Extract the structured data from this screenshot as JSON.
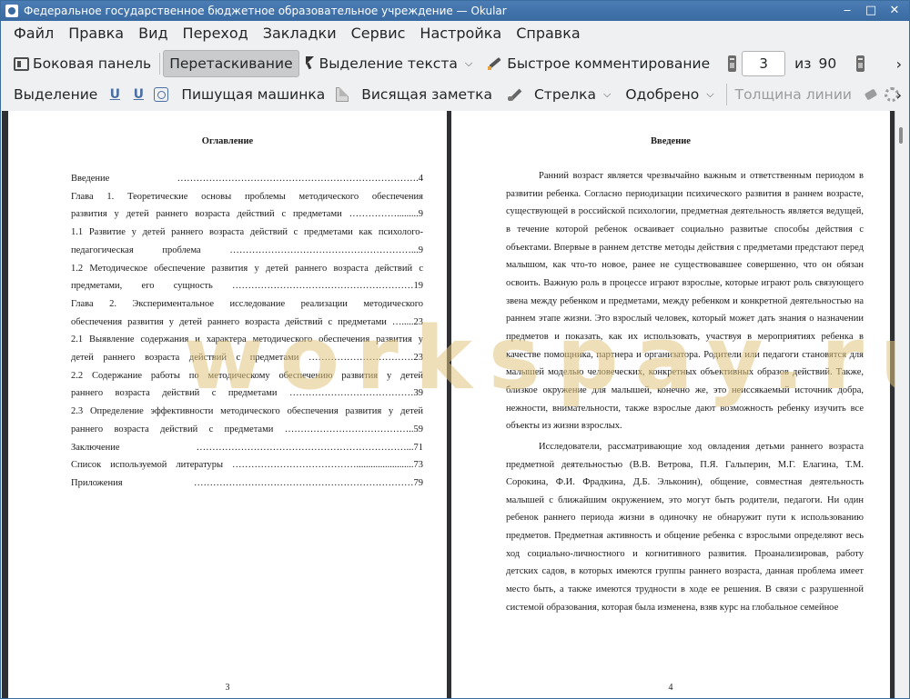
{
  "window": {
    "title": "Федеральное государственное бюджетное образовательное учреждение  — Okular"
  },
  "menu": [
    "Файл",
    "Правка",
    "Вид",
    "Переход",
    "Закладки",
    "Сервис",
    "Настройка",
    "Справка"
  ],
  "toolbar": {
    "sidebar_label": "Боковая панель",
    "drag_label": "Перетаскивание",
    "text_select_label": "Выделение текста",
    "quick_comment_label": "Быстрое комментирование",
    "current_page": "3",
    "of_label": "из",
    "total_pages": "90"
  },
  "annotbar": {
    "highlight_label": "Выделение",
    "typewriter_label": "Пишущая машинка",
    "note_label": "Висящая заметка",
    "arrow_label": "Стрелка",
    "stamp_label": "Одобрено",
    "line_width_label": "Толщина линии"
  },
  "left_page": {
    "heading": "Оглавление",
    "number": "3",
    "toc": [
      "Введение ………………………………………………………………….4",
      "Глава 1. Теоретические основы проблемы методического обеспечения",
      "развития у детей раннего возраста действий с предметами …………….........9",
      "1.1 Развитие у детей раннего возраста действий с предметами как психолого-",
      "педагогическая проблема …………………………………………………...9",
      "1.2 Методическое обеспечение развития у детей раннего возраста действий с",
      "предметами, его сущность …………………………………………………19",
      "Глава 2. Экспериментальное исследование реализации методического",
      "обеспечения развития у детей раннего возраста действий с предметами ….....23",
      "2.1 Выявление содержания и характера методического обеспечения развития у",
      "детей раннего возраста действий с предметами ……………………………23",
      "2.2 Содержание работы по методическому обеспечению развития у детей",
      "раннего возраста действий с предметами …………………………………39",
      "2.3 Определение эффективности методического обеспечения развития у детей",
      "раннего возраста действий с предметами …………………………………..59",
      "Заключение …………………………………………………………...71",
      "Список используемой литературы …………………………………........................73",
      "Приложения ……………………………………………………………79"
    ]
  },
  "right_page": {
    "heading": "Введение",
    "number": "4",
    "paragraphs": [
      "Ранний возраст является чрезвычайно важным и ответственным периодом в развитии ребенка. Согласно периодизации психического развития в раннем возрасте, существующей в российской психологии, предметная деятельность является ведущей, в течение которой ребенок осваивает социально развитые способы действия с объектами. Впервые в раннем детстве методы действия с предметами предстают перед малышом, как что-то новое, ранее не существовавшее совершенно, что он обязан освоить. Важную роль в процессе играют взрослые, которые играют роль связующего звена между ребенком и предметами, между ребенком и конкретной деятельностью на раннем этапе жизни. Это взрослый человек, который может дать знания о назначении предметов и показать, как их использовать, участвуя в мероприятиях ребенка в качестве помощника, партнера и организатора. Родители или педагоги становятся для малышей моделью человеческих, конкретных объективных образов действий. Также, близкое окружение для малышей, конечно же, это неиссякаемый источник добра, нежности, внимательности, также взрослые дают возможность ребенку изучить все объекты из жизни взрослых.",
      "Исследователи, рассматривающие ход овладения детьми раннего возраста предметной деятельностью (В.В. Ветрова, П.Я. Гальперин, М.Г. Елагина, Т.М. Сорокина, Ф.И. Фрадкина, Д.Б. Эльконин), общение, совместная деятельность малышей с ближайшим окружением, это могут быть родители, педагоги. Ни один ребенок раннего периода жизни в одиночку не обнаружит пути к использованию предметов. Предметная активность и общение ребенка с взрослыми определяют весь ход социально-личностного и когнитивного развития. Проанализировав, работу детских садов, в которых имеются группы раннего возраста, данная проблема имеет место быть, а также имеются трудности в ходе ее решения. В связи с разрушенной системой образования, которая была изменена, взяв курс на глобальное семейное"
    ]
  },
  "watermark": "workspay.ru"
}
